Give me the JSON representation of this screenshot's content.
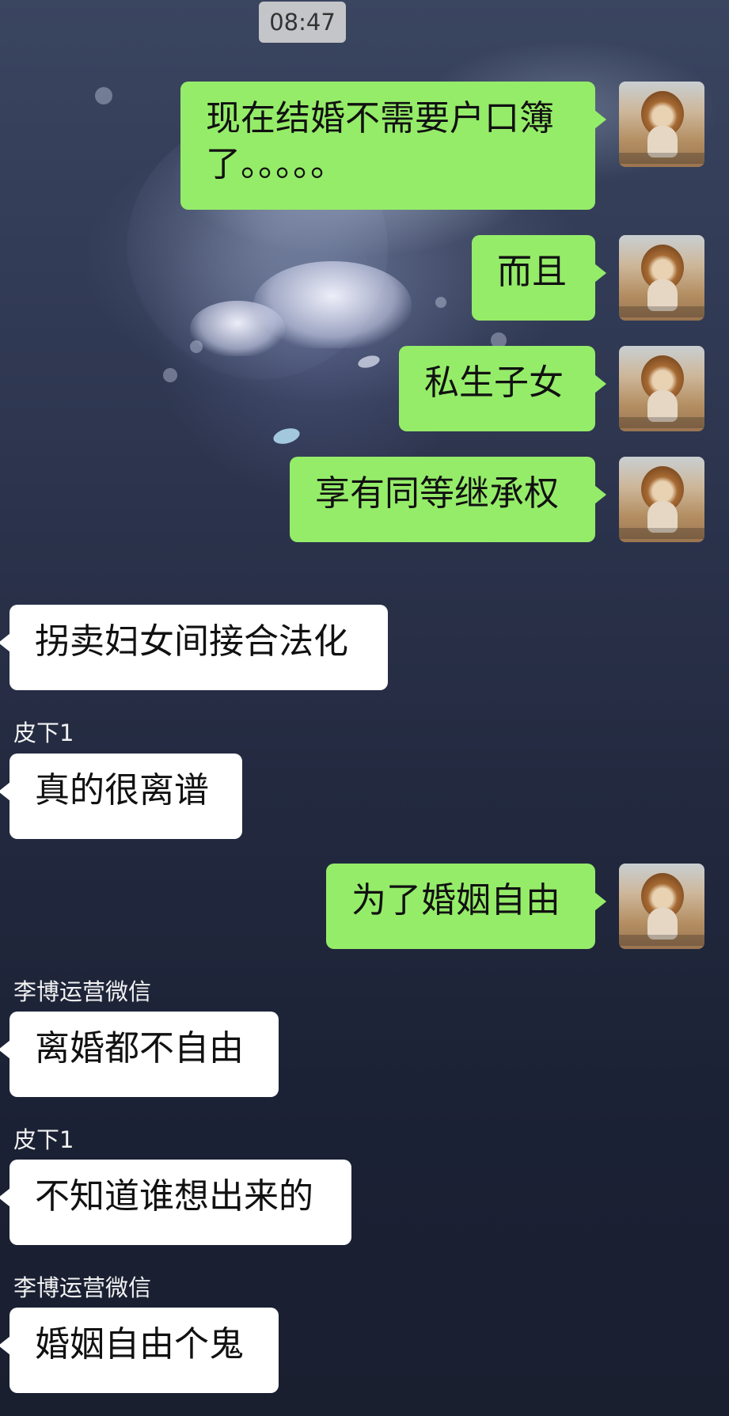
{
  "chat": {
    "timestamp": "08:47",
    "messages": [
      {
        "direction": "out",
        "lines": "现在结婚不需要户口簿\n了。。。。。"
      },
      {
        "direction": "out",
        "lines": "而且"
      },
      {
        "direction": "out",
        "lines": "私生子女"
      },
      {
        "direction": "out",
        "lines": "享有同等继承权"
      },
      {
        "direction": "in",
        "sender": "",
        "lines": "拐卖妇女间接合法化"
      },
      {
        "direction": "in",
        "sender": "皮下1",
        "lines": "真的很离谱"
      },
      {
        "direction": "out",
        "lines": "为了婚姻自由"
      },
      {
        "direction": "in",
        "sender": "李博运营微信",
        "lines": "离婚都不自由"
      },
      {
        "direction": "in",
        "sender": "皮下1",
        "lines": "不知道谁想出来的"
      },
      {
        "direction": "in",
        "sender": "李博运营微信",
        "lines": "婚姻自由个鬼"
      }
    ]
  },
  "colors": {
    "outgoing_bubble": "#95ec69",
    "incoming_bubble": "#ffffff",
    "timestamp_pill": "#d7d7d7"
  },
  "icons": {
    "avatar": "lion-cat-avatar-icon"
  }
}
